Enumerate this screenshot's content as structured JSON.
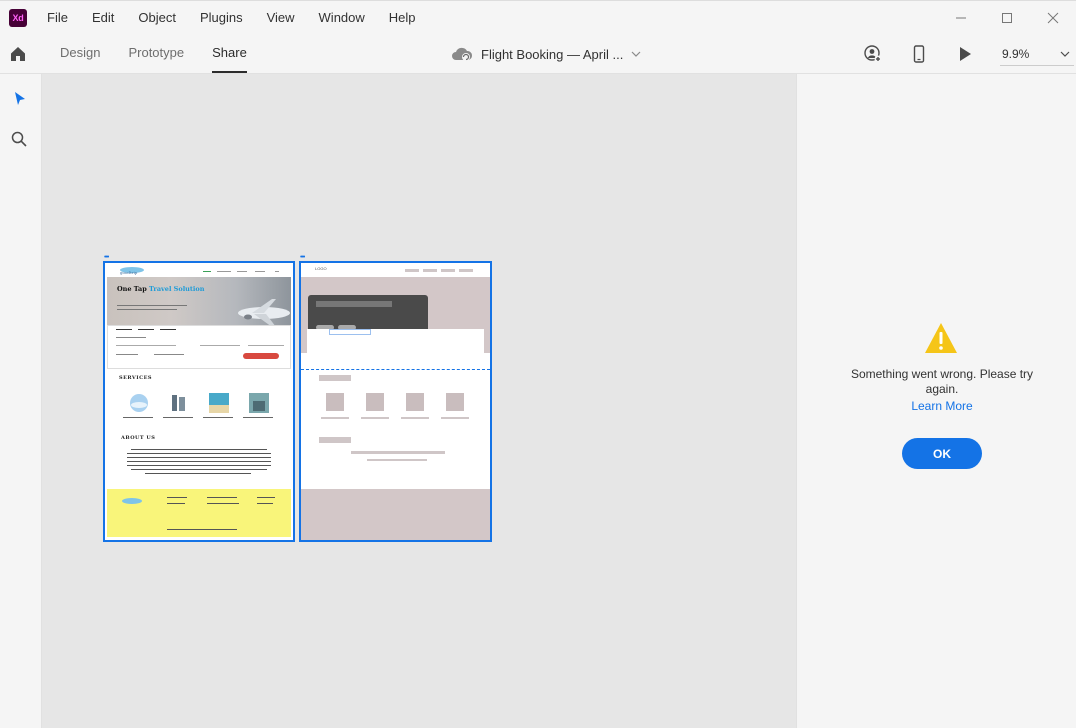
{
  "app": {
    "logo_text": "Xd",
    "window_title": "Adobe XD"
  },
  "menu": {
    "items": [
      "File",
      "Edit",
      "Object",
      "Plugins",
      "View",
      "Window",
      "Help"
    ]
  },
  "window_controls": [
    "minimize-icon",
    "maximize-icon",
    "close-icon"
  ],
  "modebar": {
    "tabs": [
      {
        "label": "Design",
        "active": false
      },
      {
        "label": "Prototype",
        "active": false
      },
      {
        "label": "Share",
        "active": true
      }
    ],
    "document_title": "Flight Booking — April ...",
    "zoom": "9.9%"
  },
  "left_toolbar": {
    "tools": [
      "select-icon",
      "zoom-search-icon"
    ]
  },
  "canvas": {
    "artboard1": {
      "hero_title_a": "One Tap",
      "hero_title_b": "Travel Solution",
      "services_title": "SERVICES",
      "about_title": "ABOUT US"
    },
    "artboard2": {
      "logo_text": "LOGO"
    }
  },
  "error_panel": {
    "message": "Something went wrong. Please try again.",
    "learn_more": "Learn More",
    "ok_label": "OK"
  },
  "colors": {
    "accent": "#1473e6",
    "warning": "#f5c518",
    "footer_yellow": "#f9f57a"
  }
}
